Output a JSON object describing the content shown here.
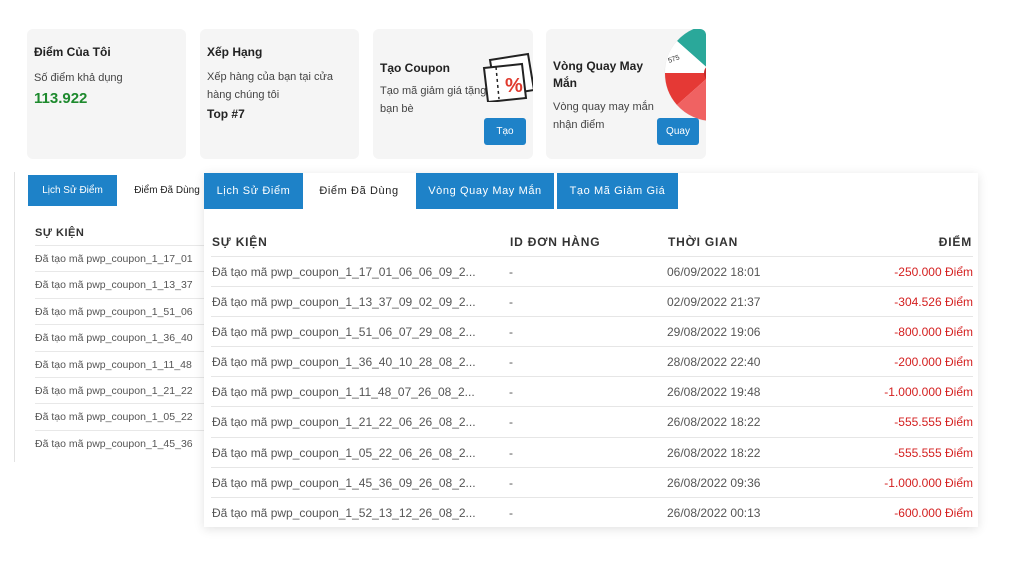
{
  "cards": {
    "points": {
      "title": "Điểm Của Tôi",
      "label": "Số điểm khả dụng",
      "value": "113.922"
    },
    "rank": {
      "title": "Xếp Hạng",
      "text_line1": "Xếp hàng của bạn tại cửa",
      "text_line2": "hàng chúng tôi",
      "value": "Top #7"
    },
    "coupon": {
      "title": "Tạo Coupon",
      "text_line1": "Tạo mã giảm giá tặng",
      "text_line2": "bạn bè",
      "button": "Tạo",
      "icon": "coupon-ticket-icon"
    },
    "spin": {
      "title_line1": "Vòng Quay May",
      "title_line2": "Mắn",
      "text_line1": "Vòng quay may mắn",
      "text_line2": "nhận điểm",
      "button": "Quay",
      "icon": "lucky-wheel-icon"
    }
  },
  "back_panel": {
    "tabs": [
      "Lịch Sử Điểm",
      "Điểm Đã Dùng"
    ],
    "header": "SỰ KIỆN",
    "rows": [
      "Đã tạo mã pwp_coupon_1_17_01",
      "Đã tạo mã pwp_coupon_1_13_37",
      "Đã tạo mã pwp_coupon_1_51_06",
      "Đã tạo mã pwp_coupon_1_36_40",
      "Đã tạo mã pwp_coupon_1_11_48",
      "Đã tạo mã pwp_coupon_1_21_22",
      "Đã tạo mã pwp_coupon_1_05_22",
      "Đã tạo mã pwp_coupon_1_45_36"
    ]
  },
  "front_panel": {
    "tabs": [
      "Lịch Sử Điểm",
      "Điểm Đã Dùng",
      "Vòng Quay May Mắn",
      "Tạo Mã Giảm Giá"
    ],
    "active_tab": "Điểm Đã Dùng",
    "columns": {
      "event": "SỰ KIỆN",
      "order_id": "ID ĐƠN HÀNG",
      "time": "THỜI GIAN",
      "points": "ĐIỂM"
    },
    "rows": [
      {
        "event": "Đã tạo mã pwp_coupon_1_17_01_06_06_09_2...",
        "order": "-",
        "time": "06/09/2022 18:01",
        "points": "-250.000 Điểm"
      },
      {
        "event": "Đã tạo mã pwp_coupon_1_13_37_09_02_09_2...",
        "order": "-",
        "time": "02/09/2022 21:37",
        "points": "-304.526 Điểm"
      },
      {
        "event": "Đã tạo mã pwp_coupon_1_51_06_07_29_08_2...",
        "order": "-",
        "time": "29/08/2022 19:06",
        "points": "-800.000 Điểm"
      },
      {
        "event": "Đã tạo mã pwp_coupon_1_36_40_10_28_08_2...",
        "order": "-",
        "time": "28/08/2022 22:40",
        "points": "-200.000 Điểm"
      },
      {
        "event": "Đã tạo mã pwp_coupon_1_11_48_07_26_08_2...",
        "order": "-",
        "time": "26/08/2022 19:48",
        "points": "-1.000.000 Điểm"
      },
      {
        "event": "Đã tạo mã pwp_coupon_1_21_22_06_26_08_2...",
        "order": "-",
        "time": "26/08/2022 18:22",
        "points": "-555.555 Điểm"
      },
      {
        "event": "Đã tạo mã pwp_coupon_1_05_22_06_26_08_2...",
        "order": "-",
        "time": "26/08/2022 18:22",
        "points": "-555.555 Điểm"
      },
      {
        "event": "Đã tạo mã pwp_coupon_1_45_36_09_26_08_2...",
        "order": "-",
        "time": "26/08/2022 09:36",
        "points": "-1.000.000 Điểm"
      },
      {
        "event": "Đã tạo mã pwp_coupon_1_52_13_12_26_08_2...",
        "order": "-",
        "time": "26/08/2022 00:13",
        "points": "-600.000 Điểm"
      }
    ]
  },
  "colors": {
    "accent": "#1e82c8",
    "positive": "#1e8a2e",
    "negative": "#d42020",
    "card_bg": "#f5f5f5"
  }
}
